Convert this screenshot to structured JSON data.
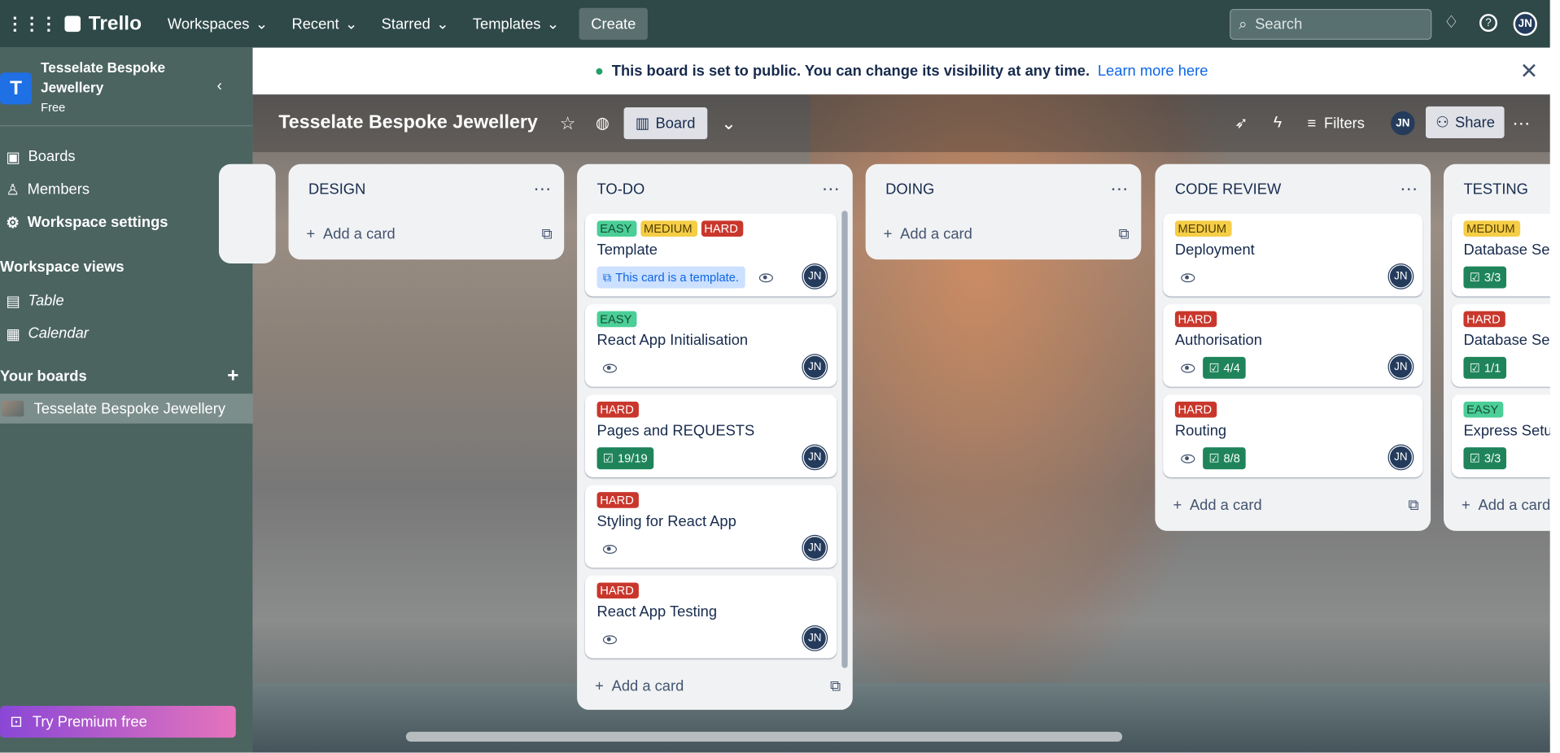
{
  "topbar": {
    "logo": "Trello",
    "nav": [
      "Workspaces",
      "Recent",
      "Starred",
      "Templates"
    ],
    "create": "Create",
    "search_placeholder": "Search",
    "user_initials": "JN"
  },
  "sidebar": {
    "workspace_letter": "T",
    "workspace_name": "Tesselate Bespoke Jewellery",
    "plan": "Free",
    "items": [
      "Boards",
      "Members",
      "Workspace settings"
    ],
    "views_title": "Workspace views",
    "views": [
      "Table",
      "Calendar"
    ],
    "your_boards": "Your boards",
    "boards": [
      "Tesselate Bespoke Jewellery"
    ],
    "premium": "Try Premium free"
  },
  "banner": {
    "message": "This board is set to public. You can change its visibility at any time.",
    "link": "Learn more here"
  },
  "boardbar": {
    "title": "Tesselate Bespoke Jewellery",
    "view": "Board",
    "filters": "Filters",
    "share": "Share",
    "user_initials": "JN"
  },
  "lists": [
    {
      "title": "DESIGN",
      "add": "Add a card"
    },
    {
      "title": "TO-DO",
      "add": "Add a card",
      "cards": [
        {
          "labels": [
            "EASY",
            "MEDIUM",
            "HARD"
          ],
          "title": "Template",
          "template": "This card is a template.",
          "avatar": "JN"
        },
        {
          "labels": [
            "EASY"
          ],
          "title": "React App Initialisation",
          "avatar": "JN"
        },
        {
          "labels": [
            "HARD"
          ],
          "title": "Pages and REQUESTS",
          "check": "19/19",
          "avatar": "JN"
        },
        {
          "labels": [
            "HARD"
          ],
          "title": "Styling for React App",
          "avatar": "JN"
        },
        {
          "labels": [
            "HARD"
          ],
          "title": "React App Testing",
          "avatar": "JN"
        }
      ]
    },
    {
      "title": "DOING",
      "add": "Add a card"
    },
    {
      "title": "CODE REVIEW",
      "add": "Add a card",
      "cards": [
        {
          "labels": [
            "MEDIUM"
          ],
          "title": "Deployment",
          "avatar": "JN"
        },
        {
          "labels": [
            "HARD"
          ],
          "title": "Authorisation",
          "check": "4/4",
          "avatar": "JN"
        },
        {
          "labels": [
            "HARD"
          ],
          "title": "Routing",
          "check": "8/8",
          "avatar": "JN"
        }
      ]
    },
    {
      "title": "TESTING",
      "add": "Add a card",
      "cards": [
        {
          "labels": [
            "MEDIUM"
          ],
          "title": "Database Setup",
          "check": "3/3"
        },
        {
          "labels": [
            "HARD"
          ],
          "title": "Database Seed",
          "check": "1/1"
        },
        {
          "labels": [
            "EASY"
          ],
          "title": "Express Setup",
          "check": "3/3"
        }
      ]
    }
  ],
  "colors": {
    "topbar": "#2f4848",
    "sidebar": "#4b6460",
    "easy": "#4bce97",
    "medium": "#f5cd47",
    "hard": "#c9372c",
    "check": "#1f845a"
  }
}
